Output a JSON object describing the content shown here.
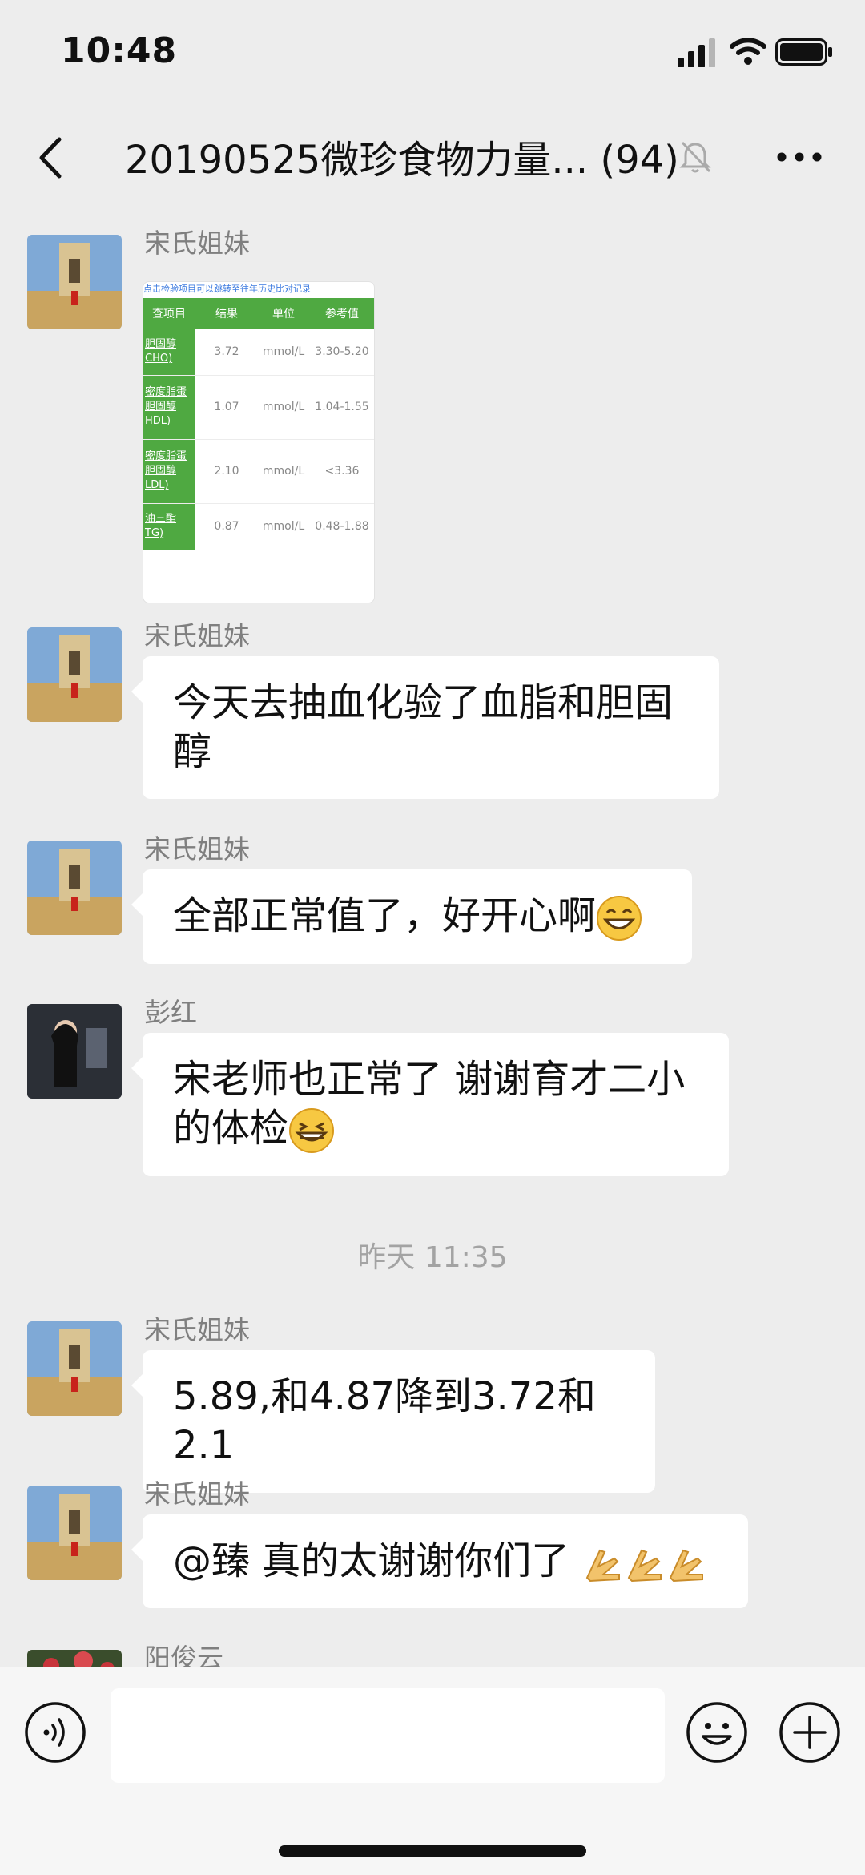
{
  "status_bar": {
    "time": "10:48"
  },
  "header": {
    "title": "20190525微珍食物力量... (94)",
    "icons": [
      "back-icon",
      "mute-bell-icon",
      "more-icon"
    ]
  },
  "messages": [
    {
      "sender": "宋氏姐妹",
      "type": "image",
      "lab_report": {
        "caption": "点击检验项目可以跳转至往年历史比对记录",
        "headers": [
          "查项目",
          "结果",
          "单位",
          "参考值"
        ],
        "rows": [
          {
            "item": "胆固醇 CHO)",
            "result": "3.72",
            "unit": "mmol/L",
            "ref": "3.30-5.20"
          },
          {
            "item": "密度脂蛋 胆固醇 HDL)",
            "result": "1.07",
            "unit": "mmol/L",
            "ref": "1.04-1.55"
          },
          {
            "item": "密度脂蛋 胆固醇 LDL)",
            "result": "2.10",
            "unit": "mmol/L",
            "ref": "<3.36"
          },
          {
            "item": "油三酯 TG)",
            "result": "0.87",
            "unit": "mmol/L",
            "ref": "0.48-1.88"
          }
        ]
      }
    },
    {
      "sender": "宋氏姐妹",
      "text_line1": "今天去抽血化验了血脂和胆固",
      "text_line2": "醇"
    },
    {
      "sender": "宋氏姐妹",
      "text": "全部正常值了，好开心啊"
    },
    {
      "sender": "彭红",
      "text_line1": "宋老师也正常了 谢谢育才二小",
      "text_line2": "的体检"
    },
    {
      "time_divider": "昨天 11:35"
    },
    {
      "sender": "宋氏姐妹",
      "text": "5.89,和4.87降到3.72和2.1"
    },
    {
      "sender": "宋氏姐妹",
      "text": "@臻 真的太谢谢你们了"
    },
    {
      "sender": "阳俊云"
    }
  ],
  "input_bar": {
    "placeholder": "",
    "icons": [
      "voice-icon",
      "emoji-icon",
      "plus-icon"
    ]
  },
  "colors": {
    "background": "#ededed",
    "bubble": "#ffffff",
    "lab_green": "#4fa941",
    "sender_gray": "#7f7f7f"
  }
}
